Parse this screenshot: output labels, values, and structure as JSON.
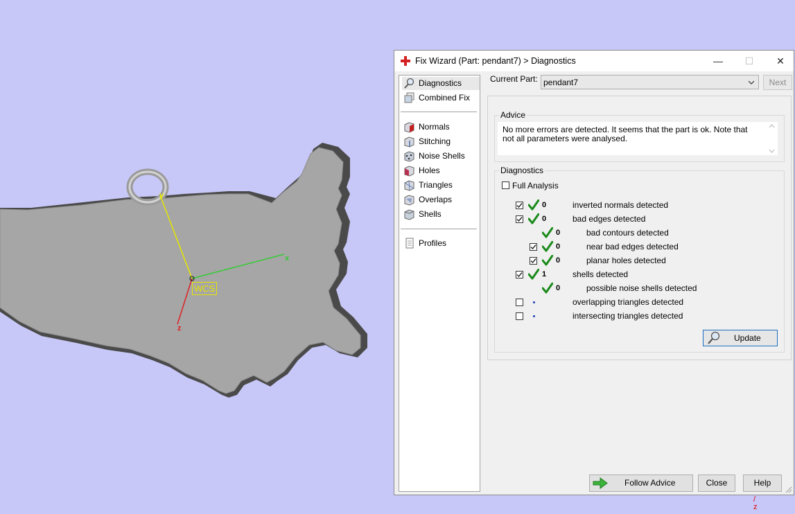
{
  "viewport": {
    "wcs_label": "WCS",
    "axis_x": "x",
    "axis_y": "y",
    "axis_z": "z",
    "stray_axis": "/\nz"
  },
  "dialog": {
    "title": "Fix Wizard (Part: pendant7) > Diagnostics",
    "window_controls": [
      "—",
      "☐",
      "✕"
    ]
  },
  "nav": {
    "items": [
      {
        "label": "Diagnostics",
        "icon": "magnifier-icon",
        "selected": true
      },
      {
        "label": "Combined Fix",
        "icon": "layers-icon"
      },
      {
        "label": "Normals",
        "icon": "normals-cube-icon"
      },
      {
        "label": "Stitching",
        "icon": "stitching-cube-icon"
      },
      {
        "label": "Noise Shells",
        "icon": "noise-shells-icon"
      },
      {
        "label": "Holes",
        "icon": "holes-cube-icon"
      },
      {
        "label": "Triangles",
        "icon": "triangles-cube-icon"
      },
      {
        "label": "Overlaps",
        "icon": "overlaps-cube-icon"
      },
      {
        "label": "Shells",
        "icon": "shells-cube-icon"
      },
      {
        "label": "Profiles",
        "icon": "profiles-icon"
      }
    ]
  },
  "current_part": {
    "label": "Current Part:",
    "value": "pendant7",
    "next_label": "Next"
  },
  "advice": {
    "title": "Advice",
    "text": "No more errors are detected. It seems that the part is ok. Note that not all parameters were analysed."
  },
  "diagnostics": {
    "title": "Diagnostics",
    "full_analysis_label": "Full Analysis",
    "full_analysis_checked": false,
    "rows": [
      {
        "checkbox": true,
        "checked": true,
        "status": "ok",
        "count": "0",
        "label": "inverted normals detected",
        "indent": 0
      },
      {
        "checkbox": true,
        "checked": true,
        "status": "ok",
        "count": "0",
        "label": "bad edges detected",
        "indent": 0
      },
      {
        "checkbox": false,
        "checked": false,
        "status": "ok",
        "count": "0",
        "label": "bad contours detected",
        "indent": 1
      },
      {
        "checkbox": true,
        "checked": true,
        "status": "ok",
        "count": "0",
        "label": "near bad edges detected",
        "indent": 1
      },
      {
        "checkbox": true,
        "checked": true,
        "status": "ok",
        "count": "0",
        "label": "planar holes detected",
        "indent": 1
      },
      {
        "checkbox": true,
        "checked": true,
        "status": "ok",
        "count": "1",
        "label": "shells detected",
        "indent": 0
      },
      {
        "checkbox": false,
        "checked": false,
        "status": "ok",
        "count": "0",
        "label": "possible noise shells detected",
        "indent": 1
      },
      {
        "checkbox": true,
        "checked": false,
        "status": "dot",
        "count": "",
        "label": "overlapping triangles detected",
        "indent": 0
      },
      {
        "checkbox": true,
        "checked": false,
        "status": "dot",
        "count": "",
        "label": "intersecting triangles detected",
        "indent": 0
      }
    ],
    "update_label": "Update"
  },
  "footer": {
    "follow_advice_label": "Follow Advice",
    "close_label": "Close",
    "help_label": "Help"
  },
  "colors": {
    "background": "#c8c8f8",
    "model": "#a6a6a6",
    "axis_x": "#33cc33",
    "axis_y": "#e6e600",
    "axis_z": "#dd2222",
    "check": "#1a8a1a",
    "focus": "#1b6ec2"
  }
}
